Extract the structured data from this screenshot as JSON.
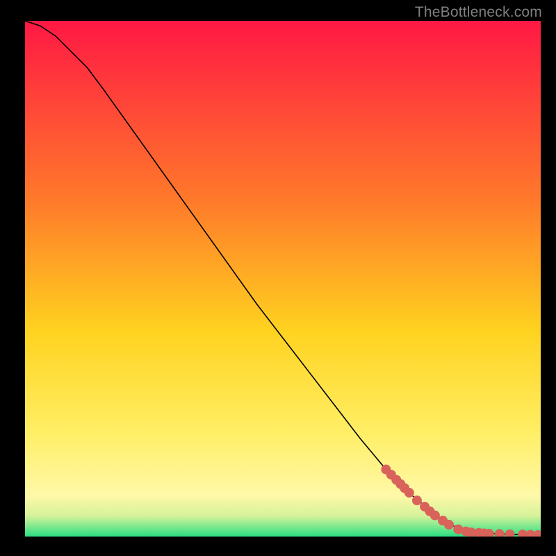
{
  "watermark": "TheBottleneck.com",
  "chart_data": {
    "type": "line",
    "title": "",
    "xlabel": "",
    "ylabel": "",
    "xlim": [
      0,
      100
    ],
    "ylim": [
      0,
      100
    ],
    "grid": false,
    "curve": {
      "x": [
        0,
        3,
        6,
        9,
        12,
        15,
        20,
        25,
        30,
        35,
        40,
        45,
        50,
        55,
        60,
        65,
        70,
        75,
        80,
        84,
        88,
        92,
        96,
        100
      ],
      "y": [
        100,
        99,
        97,
        94,
        91,
        87,
        80,
        73,
        66,
        59,
        52,
        45,
        38.5,
        32,
        25.5,
        19,
        13,
        8,
        4,
        1.5,
        0.8,
        0.5,
        0.4,
        0.3
      ]
    },
    "markers": {
      "xy": [
        [
          70.0,
          13.0
        ],
        [
          71.0,
          12.0
        ],
        [
          72.0,
          11.0
        ],
        [
          72.8,
          10.2
        ],
        [
          73.6,
          9.4
        ],
        [
          74.5,
          8.5
        ],
        [
          76.0,
          7.0
        ],
        [
          77.5,
          5.8
        ],
        [
          78.5,
          4.9
        ],
        [
          79.5,
          4.1
        ],
        [
          81.0,
          3.1
        ],
        [
          82.2,
          2.3
        ],
        [
          84.0,
          1.4
        ],
        [
          85.5,
          1.0
        ],
        [
          86.5,
          0.8
        ],
        [
          88.0,
          0.7
        ],
        [
          89.0,
          0.6
        ],
        [
          90.0,
          0.55
        ],
        [
          92.0,
          0.5
        ],
        [
          94.0,
          0.45
        ],
        [
          96.5,
          0.4
        ],
        [
          98.0,
          0.35
        ],
        [
          99.5,
          0.3
        ]
      ]
    },
    "colors": {
      "gradient_top": "#ff1844",
      "gradient_mid1": "#ff7a2a",
      "gradient_mid2": "#ffd21f",
      "gradient_mid3": "#ffef66",
      "gradient_mid4": "#fff8a8",
      "gradient_bottom": "#2adf82",
      "curve": "#000000",
      "marker": "#d9625b"
    }
  }
}
